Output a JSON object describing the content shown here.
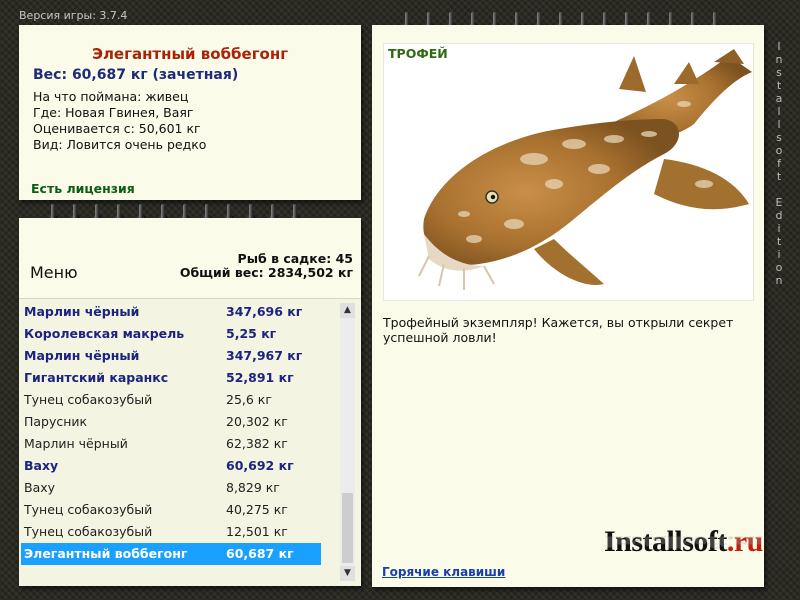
{
  "version_text": "Версия игры: 3.7.4",
  "edition_text": "Installsoft Edition",
  "info": {
    "title": "Элегантный воббегонг",
    "weight": "Вес: 60,687 кг (зачетная)",
    "caught_on": "На что поймана: живец",
    "where": "Где: Новая Гвинея, Ваяг",
    "valued_from": "Оценивается с: 50,601 кг",
    "kind": "Вид: Ловится очень редко",
    "license": "Есть лицензия"
  },
  "menu": {
    "title": "Меню",
    "fish_count": "Рыб в садке: 45",
    "total_weight": "Общий вес: 2834,502 кг"
  },
  "catch_list": [
    {
      "name": "Марлин чёрный",
      "weight": "347,696 кг",
      "bold": true
    },
    {
      "name": "Королевская макрель",
      "weight": "5,25 кг",
      "bold": true
    },
    {
      "name": "Марлин чёрный",
      "weight": "347,967 кг",
      "bold": true
    },
    {
      "name": "Гигантский каранкс",
      "weight": "52,891 кг",
      "bold": true
    },
    {
      "name": "Тунец собакозубый",
      "weight": "25,6 кг",
      "bold": false
    },
    {
      "name": "Парусник",
      "weight": "20,302 кг",
      "bold": false
    },
    {
      "name": "Марлин чёрный",
      "weight": "62,382 кг",
      "bold": false
    },
    {
      "name": "Ваху",
      "weight": "60,692 кг",
      "bold": true
    },
    {
      "name": "Ваху",
      "weight": "8,829 кг",
      "bold": false
    },
    {
      "name": "Тунец собакозубый",
      "weight": "40,275 кг",
      "bold": false
    },
    {
      "name": "Тунец собакозубый",
      "weight": "12,501 кг",
      "bold": false
    },
    {
      "name": "Элегантный воббегонг",
      "weight": "60,687 кг",
      "bold": true,
      "selected": true
    }
  ],
  "trophy": {
    "label": "ТРОФЕЙ",
    "message": "Трофейный экземпляр! Кажется, вы открыли секрет успешной ловли!",
    "hotkeys_link": "Горячие клавиши"
  },
  "logo": {
    "main": "Installsoft",
    "dot": ".",
    "suffix": "ru"
  },
  "colors": {
    "title": "#a8230a",
    "weight": "#1f2a7a",
    "license": "#0b5d12",
    "selection": "#1aa0ff",
    "link": "#1a3fa8"
  }
}
